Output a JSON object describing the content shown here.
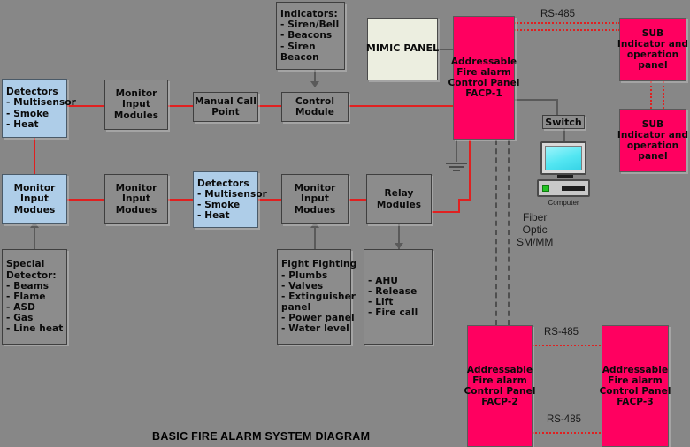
{
  "diagram": {
    "title": "BASIC FIRE ALARM SYSTEM DIAGRAM",
    "background_color": "#878787",
    "accent_pink": "#FF0060",
    "accent_blue": "#AECDE8",
    "accent_cream": "#ECEEE0",
    "wire_red": "#E02020"
  },
  "boxes": {
    "detectors_top": {
      "lines": [
        "Detectors",
        "- Multisensor",
        "- Smoke",
        "- Heat"
      ],
      "color": "blue"
    },
    "monitor_input_modules_1": {
      "lines": [
        "Monitor",
        "Input",
        "Modules"
      ],
      "color": "gray"
    },
    "manual_call_point": {
      "lines": [
        "Manual Call",
        "Point"
      ],
      "color": "gray"
    },
    "control_module": {
      "lines": [
        "Control",
        "Module"
      ],
      "color": "gray"
    },
    "indicators": {
      "lines": [
        "Indicators:",
        "- Siren/Bell",
        "- Beacons",
        "- Siren",
        "Beacon"
      ],
      "color": "gray"
    },
    "mimic_panel": {
      "lines": [
        "MIMIC PANEL"
      ],
      "color": "cream"
    },
    "facp_1": {
      "lines": [
        "Addressable",
        "Fire alarm",
        "Control Panel",
        "FACP-1"
      ],
      "color": "pink"
    },
    "sub_panel_1": {
      "lines": [
        "SUB",
        "Indicator and",
        "operation",
        "panel"
      ],
      "color": "pink"
    },
    "sub_panel_2": {
      "lines": [
        "SUB",
        "Indicator and",
        "operation",
        "panel"
      ],
      "color": "pink"
    },
    "monitor_input_modues_left": {
      "lines": [
        "Monitor",
        "Input",
        "Modues"
      ],
      "color": "blue"
    },
    "monitor_input_modues_2": {
      "lines": [
        "Monitor",
        "Input",
        "Modues"
      ],
      "color": "gray"
    },
    "detectors_mid": {
      "lines": [
        "Detectors",
        "- Multisensor",
        "- Smoke",
        "- Heat"
      ],
      "color": "blue"
    },
    "monitor_input_modues_3": {
      "lines": [
        "Monitor",
        "Input",
        "Modues"
      ],
      "color": "gray"
    },
    "relay_modules": {
      "lines": [
        "Relay",
        "Modules"
      ],
      "color": "gray"
    },
    "special_detector": {
      "lines": [
        "Special",
        "Detector:",
        "- Beams",
        "- Flame",
        "- ASD",
        "- Gas",
        "- Line heat"
      ],
      "color": "gray"
    },
    "fight_fighting": {
      "lines": [
        "Fight Fighting",
        "- Plumbs",
        "- Valves",
        "- Extinguisher",
        "panel",
        "- Power panel",
        "- Water level"
      ],
      "color": "gray"
    },
    "ahu_list": {
      "lines": [
        "- AHU",
        "- Release",
        "- Lift",
        "- Fire call"
      ],
      "color": "gray"
    },
    "facp_2": {
      "lines": [
        "Addressable",
        "Fire alarm",
        "Control Panel",
        "FACP-2"
      ],
      "color": "pink"
    },
    "facp_3": {
      "lines": [
        "Addressable",
        "Fire alarm",
        "Control Panel",
        "FACP-3"
      ],
      "color": "pink"
    }
  },
  "network": {
    "switch_label": "Switch",
    "computer_label": "Computer"
  },
  "labels": {
    "rs485_top": "RS-485",
    "rs485_mid": "RS-485",
    "rs485_bottom": "RS-485",
    "fiber_optic": "Fiber\nOptic\nSM/MM"
  }
}
